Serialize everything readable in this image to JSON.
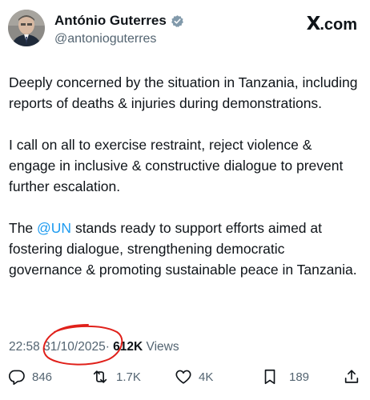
{
  "profile": {
    "display_name": "António Guterres",
    "handle": "@antonioguterres",
    "verified_icon": "verified-badge-icon",
    "verified_color": "#829aab"
  },
  "brand": {
    "x": "X",
    ".com": ".com"
  },
  "tweet": {
    "paragraph1": "Deeply concerned by the situation in Tanzania, including reports of deaths & injuries during demonstrations.",
    "paragraph2": "I call on all to exercise restraint, reject violence & engage in inclusive & constructive dialogue to prevent further escalation.",
    "p3_before": "The ",
    "p3_mention": "@UN",
    "p3_after": " stands ready to support efforts aimed at fostering dialogue, strengthening democratic governance & promoting sustainable peace in Tanzania."
  },
  "meta": {
    "time": "22:58",
    "date": "31/10/2025",
    "separator": "·",
    "views_count": "612K",
    "views_label": "Views"
  },
  "actions": {
    "replies": "846",
    "reposts": "1.7K",
    "likes": "4K",
    "bookmarks": "189",
    "reply_icon": "reply-icon",
    "repost_icon": "repost-icon",
    "like_icon": "heart-icon",
    "bookmark_icon": "bookmark-icon",
    "share_icon": "share-icon"
  },
  "colors": {
    "text": "#0f1419",
    "secondary": "#536471",
    "link": "#1d9bf0",
    "annotation": "#e0201a"
  }
}
